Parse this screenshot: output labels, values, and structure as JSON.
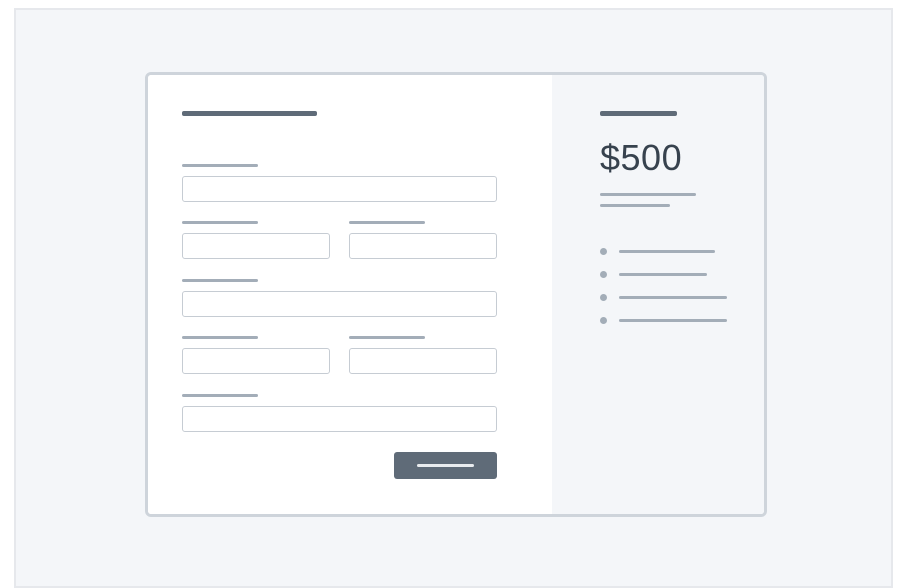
{
  "summary": {
    "price": "$500"
  },
  "features": [
    {},
    {},
    {},
    {}
  ],
  "colors": {
    "primary": "#5f6b78",
    "placeholder_bar": "#a3adb8",
    "field_border": "#c6ccd3",
    "summary_bg": "#f4f6f9",
    "price_text": "#37424e"
  }
}
